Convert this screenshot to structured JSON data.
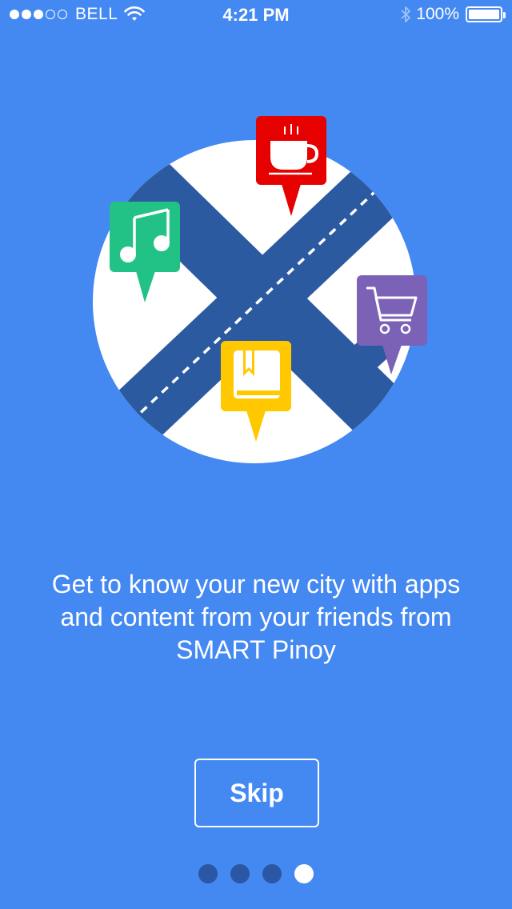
{
  "status_bar": {
    "signal_strength": 3,
    "signal_total": 5,
    "carrier": "BELL",
    "time": "4:21 PM",
    "battery_percent": "100%",
    "icons": [
      "signal-dots-icon",
      "wifi-icon",
      "bluetooth-icon",
      "battery-icon"
    ]
  },
  "illustration": {
    "circle_color": "#ffffff",
    "road_color": "#2c5aa0",
    "pins": [
      {
        "icon": "coffee-cup-icon",
        "color": "#e60000"
      },
      {
        "icon": "music-note-icon",
        "color": "#22c287"
      },
      {
        "icon": "shopping-cart-icon",
        "color": "#7b62b6"
      },
      {
        "icon": "book-icon",
        "color": "#ffc800"
      }
    ]
  },
  "onboarding": {
    "description": "Get to know your new city with apps and content from your friends from SMART Pinoy",
    "skip_label": "Skip"
  },
  "pagination": {
    "total": 4,
    "active_index": 3
  },
  "colors": {
    "background": "#4488f2",
    "dot_inactive": "#2a58a6",
    "dot_active": "#ffffff"
  }
}
